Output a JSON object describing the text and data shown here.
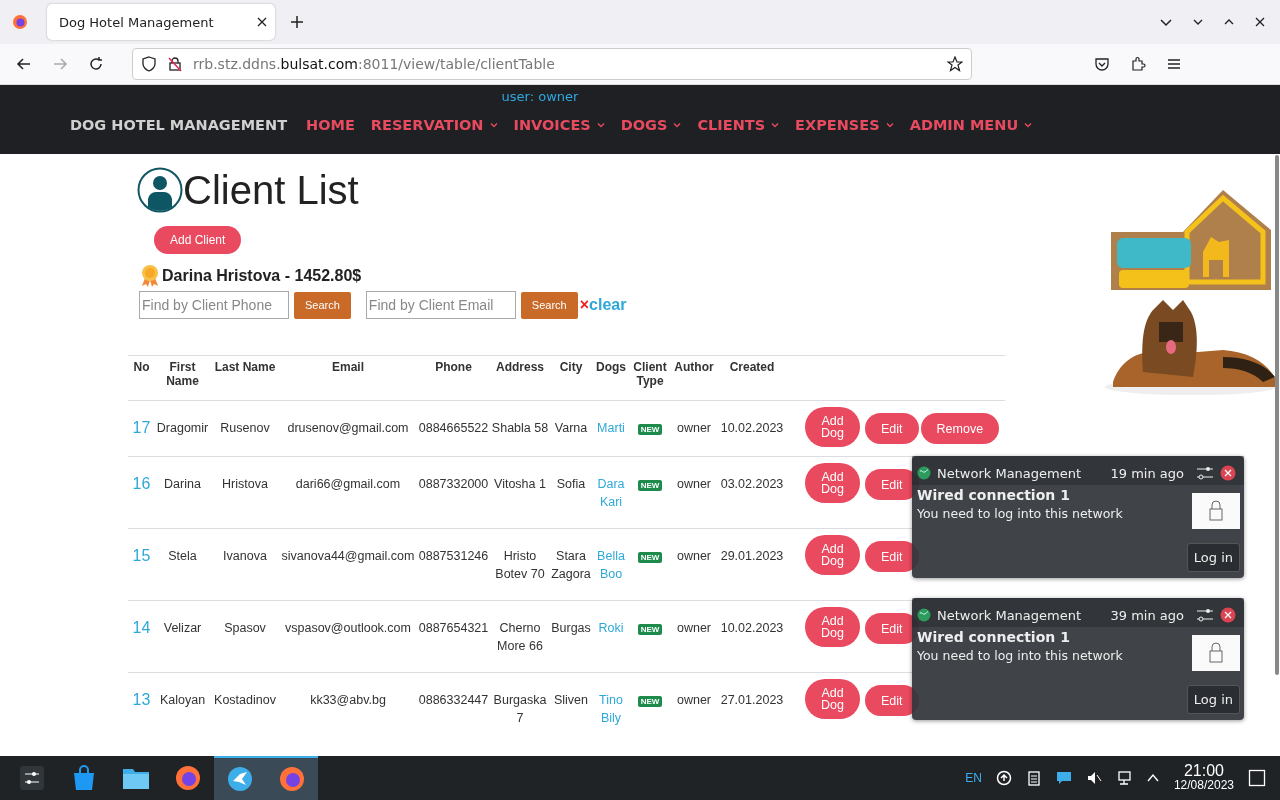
{
  "browser": {
    "tab_title": "Dog Hotel Management",
    "url": "rrb.stz.ddns.**bulsat.com**:8011/view/table/clientTable"
  },
  "nav": {
    "user": "user: owner",
    "brand": "DOG HOTEL MANAGEMENT",
    "items": [
      {
        "label": "HOME",
        "has_menu": false
      },
      {
        "label": "RESERVATION",
        "has_menu": true
      },
      {
        "label": "INVOICES",
        "has_menu": true
      },
      {
        "label": "DOGS",
        "has_menu": true
      },
      {
        "label": "CLIENTS",
        "has_menu": true
      },
      {
        "label": "EXPENSES",
        "has_menu": true
      },
      {
        "label": "ADMIN MENU",
        "has_menu": true
      }
    ]
  },
  "page": {
    "title": "Client List",
    "add_button": "Add Client",
    "top_client": "Darina Hristova - 1452.80$",
    "search": {
      "phone_placeholder": "Find by Client Phone",
      "phone_button": "Search",
      "email_placeholder": "Find by Client Email",
      "email_button": "Search",
      "clear_mark": "×",
      "clear": "clear"
    }
  },
  "table": {
    "columns": [
      "No",
      "First Name",
      "Last Name",
      "Email",
      "Phone",
      "Address",
      "City",
      "Dogs",
      "Client Type",
      "Author",
      "Created"
    ],
    "rows": [
      {
        "no": "17",
        "first": "Dragomir",
        "last": "Rusenov",
        "email": "drusenov@gmail.com",
        "phone": "0884665522",
        "address": "Shabla 58",
        "city": "Varna",
        "dogs": [
          "Marti"
        ],
        "client_type": "NEW",
        "author": "owner",
        "created": "10.02.2023",
        "actions": [
          "Add Dog",
          "Edit",
          "Remove"
        ]
      },
      {
        "no": "16",
        "first": "Darina",
        "last": "Hristova",
        "email": "dari66@gmail.com",
        "phone": "0887332000",
        "address": "Vitosha 1",
        "city": "Sofia",
        "dogs": [
          "Dara",
          "Kari"
        ],
        "client_type": "NEW",
        "author": "owner",
        "created": "03.02.2023",
        "actions": [
          "Add Dog",
          "Edit"
        ]
      },
      {
        "no": "15",
        "first": "Stela",
        "last": "Ivanova",
        "email": "sivanova44@gmail.com",
        "phone": "0887531246",
        "address": "Hristo Botev 70",
        "city": "Stara Zagora",
        "dogs": [
          "Bella",
          "Boo"
        ],
        "client_type": "NEW",
        "author": "owner",
        "created": "29.01.2023",
        "actions": [
          "Add Dog",
          "Edit"
        ]
      },
      {
        "no": "14",
        "first": "Velizar",
        "last": "Spasov",
        "email": "vspasov@outlook.com",
        "phone": "0887654321",
        "address": "Cherno More 66",
        "city": "Burgas",
        "dogs": [
          "Roki"
        ],
        "client_type": "NEW",
        "author": "owner",
        "created": "10.02.2023",
        "actions": [
          "Add Dog",
          "Edit"
        ]
      },
      {
        "no": "13",
        "first": "Kaloyan",
        "last": "Kostadinov",
        "email": "kk33@abv.bg",
        "phone": "0886332447",
        "address": "Burgaska 7",
        "city": "Sliven",
        "dogs": [
          "Tino",
          "Bily"
        ],
        "client_type": "NEW",
        "author": "owner",
        "created": "27.01.2023",
        "actions": [
          "Add Dog",
          "Edit"
        ]
      }
    ]
  },
  "notifications": [
    {
      "app": "Network Management",
      "time": "19 min ago",
      "title": "Wired connection 1",
      "body": "You need to log into this network",
      "button": "Log in"
    },
    {
      "app": "Network Management",
      "time": "39 min ago",
      "title": "Wired connection 1",
      "body": "You need to log into this network",
      "button": "Log in"
    }
  ],
  "taskbar": {
    "apps": [
      {
        "kind": "settings",
        "active": false
      },
      {
        "kind": "store",
        "active": false
      },
      {
        "kind": "folder",
        "active": false
      },
      {
        "kind": "firefox",
        "active": false
      },
      {
        "kind": "bird",
        "active": true
      },
      {
        "kind": "firefox",
        "active": true
      }
    ],
    "lang": "EN",
    "time": "21:00",
    "date": "12/08/2023"
  }
}
